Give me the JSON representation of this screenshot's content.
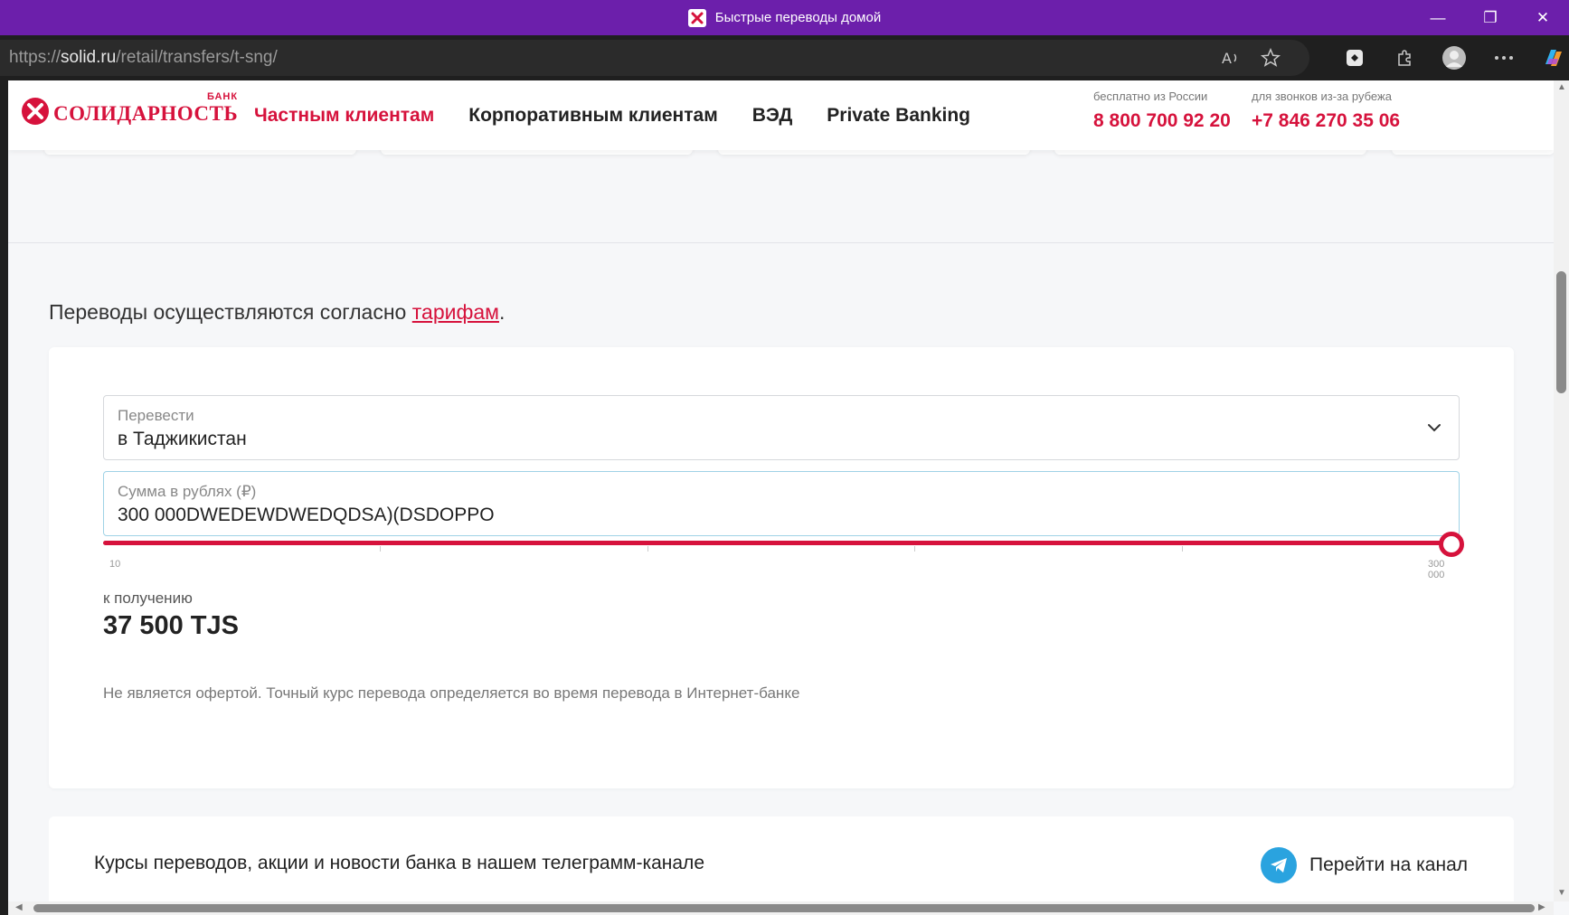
{
  "window": {
    "title": "Быстрые переводы домой",
    "minimize": "—",
    "restore": "❐",
    "close": "✕"
  },
  "browser": {
    "url_prefix": "https://",
    "url_host": "solid.ru",
    "url_path": "/retail/transfers/t-sng/"
  },
  "header": {
    "logo_bank": "БАНК",
    "logo_name": "СОЛИДАРНОСТЬ",
    "nav": [
      "Частным клиентам",
      "Корпоративным клиентам",
      "ВЭД",
      "Private Banking"
    ],
    "phone_ru_caption": "бесплатно из России",
    "phone_ru": "8 800 700 92 20",
    "phone_abroad_caption": "для звонков из-за рубежа",
    "phone_abroad": "+7 846 270 35 06"
  },
  "page": {
    "tariff_prefix": "Переводы осуществляются согласно ",
    "tariff_link": "тарифам",
    "tariff_suffix": "."
  },
  "calculator": {
    "direction_label": "Перевести",
    "direction_value": "в Таджикистан",
    "amount_label": "Сумма в рублях (₽)",
    "amount_value": "300 000DWEDEWDWEDQDSA)(DSDOPPO",
    "slider_min": "10",
    "slider_max": "300 000",
    "slider_level": 1.0,
    "receive_label": "к получению",
    "receive_value": "37 500 TJS",
    "disclaimer": "Не является офертой. Точный курс перевода определяется во время перевода в Интернет-банке"
  },
  "telegram": {
    "text": "Курсы переводов, акции и новости банка в нашем телеграмм-канале",
    "link": "Перейти на канал"
  },
  "colors": {
    "titlebar": "#6c1fab",
    "brand": "#d6123c",
    "telegram": "#2aa3df"
  }
}
